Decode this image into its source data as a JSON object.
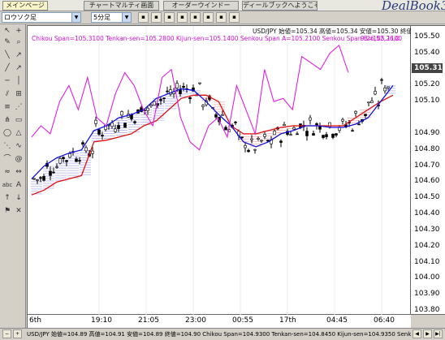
{
  "tabs": [
    "メインページ",
    "チャートマルティ画面",
    "オーダーウインドー",
    "ディールブックへようこそ"
  ],
  "logo": "DealBook360",
  "toolbar": {
    "chart_type": "ロウソク足",
    "interval": "5分足"
  },
  "chart": {
    "symbol_line": "USD/JPY 始値=105.34 高値=105.34 安値=105.30 終値=105.31",
    "ichimoku_legend": "Chikou Span=105.3100 Tenkan-sen=105.2800 Kijun-sen=105.1400 Senkou Span A=105.2100 Senkou Span B=105.1100",
    "future_tag": "9:26,52,26,0",
    "current_price": "105.31",
    "y_ticks": [
      "105.50",
      "105.40",
      "105.20",
      "105.10",
      "104.90",
      "104.80",
      "104.70",
      "104.60",
      "104.50",
      "104.40",
      "104.30",
      "104.20",
      "104.10",
      "104.00",
      "103.90",
      "103.80"
    ],
    "x_ticks": [
      "6th",
      "19:10",
      "21:05",
      "23:00",
      "00:55",
      "17th",
      "04:45",
      "06:40"
    ],
    "colors": {
      "chikou": "#e020e0",
      "tenkan": "#1010e0",
      "kijun": "#e01010",
      "cloud_bull": "#3030d0",
      "cloud_bear": "#e03030",
      "candle": "#000000"
    }
  },
  "chart_data": {
    "type": "line",
    "title": "USD/JPY",
    "ylim": [
      103.78,
      105.56
    ],
    "series": [
      {
        "name": "Chikou Span",
        "values": [
          104.88,
          104.95,
          104.9,
          105.1,
          105.2,
          105.05,
          105.25,
          105.0,
          104.95,
          105.15,
          105.28,
          105.2,
          105.05,
          104.95,
          105.25,
          105.3,
          105.0,
          104.85,
          104.8,
          104.95,
          105.0,
          104.88,
          105.2,
          105.05,
          104.9,
          105.3,
          105.1,
          105.12,
          105.05,
          105.38,
          105.34,
          105.3,
          105.4,
          105.45,
          105.28
        ]
      },
      {
        "name": "Tenkan-sen",
        "values": [
          104.62,
          104.7,
          104.75,
          104.78,
          104.8,
          104.92,
          104.95,
          105.0,
          105.02,
          105.05,
          105.12,
          105.15,
          105.18,
          105.17,
          105.1,
          105.02,
          104.95,
          104.85,
          104.82,
          104.85,
          104.9,
          104.92,
          104.95,
          104.95,
          104.94,
          104.94,
          104.96,
          105.0,
          105.1,
          105.2
        ]
      },
      {
        "name": "Kijun-sen",
        "values": [
          104.52,
          104.55,
          104.6,
          104.62,
          104.64,
          104.85,
          104.86,
          104.88,
          104.9,
          104.95,
          104.98,
          105.05,
          105.12,
          105.14,
          105.14,
          105.1,
          104.95,
          104.9,
          104.9,
          104.92,
          104.94,
          104.95,
          104.95,
          104.95,
          104.95,
          104.95,
          105.0,
          105.05,
          105.1,
          105.14
        ]
      }
    ]
  },
  "status_bar": "USD/JPY 始値=104.89 高値=104.91 安値=104.89 終値=104.90 Chikou Span=104.9300 Tenkan-sen=104.8450 Kijun-sen=104.9350 Senk"
}
